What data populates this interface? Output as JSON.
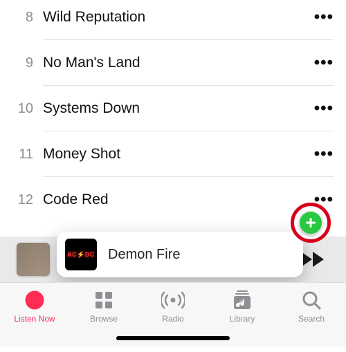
{
  "tracks": [
    {
      "num": "8",
      "title": "Wild Reputation"
    },
    {
      "num": "9",
      "title": "No Man's Land"
    },
    {
      "num": "10",
      "title": "Systems Down"
    },
    {
      "num": "11",
      "title": "Money Shot"
    },
    {
      "num": "12",
      "title": "Code Red"
    }
  ],
  "now_playing": {
    "toast_title": "Demon Fire",
    "toast_thumb_text": "AC⚡DC"
  },
  "tabs": {
    "listen_now": "Listen Now",
    "browse": "Browse",
    "radio": "Radio",
    "library": "Library",
    "search": "Search"
  },
  "colors": {
    "accent": "#ff2d55",
    "add_button": "#28c840",
    "annotation_ring": "#d9001b"
  }
}
